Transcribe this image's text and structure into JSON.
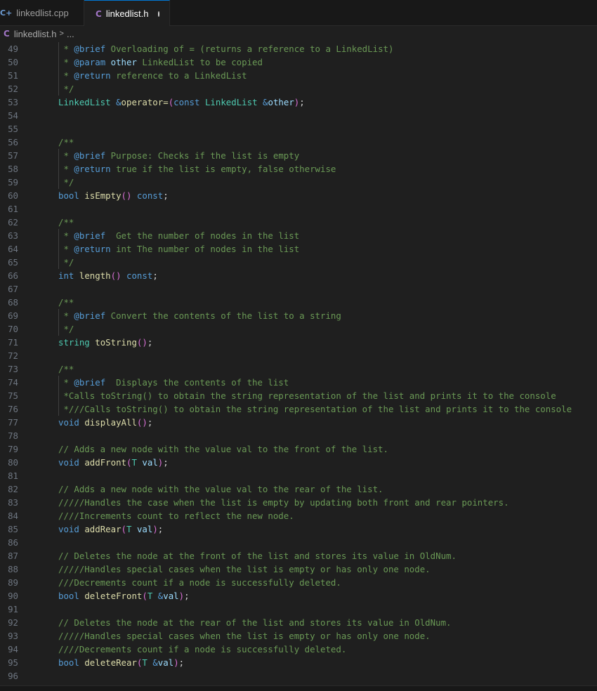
{
  "tabs": [
    {
      "icon": "C+",
      "label": "linkedlist.cpp",
      "active": false
    },
    {
      "icon": "C",
      "label": "linkedlist.h",
      "active": true,
      "dirty": true
    }
  ],
  "breadcrumb": {
    "icon": "C",
    "file": "linkedlist.h",
    "separator": ">",
    "rest": "..."
  },
  "editor": {
    "lines": [
      {
        "n": "49",
        "guide": true,
        "tokens": [
          [
            "comment",
            " * "
          ],
          [
            "doc",
            "@brief"
          ],
          [
            "comment",
            " Overloading of = (returns a reference to a LinkedList)"
          ]
        ]
      },
      {
        "n": "50",
        "guide": true,
        "tokens": [
          [
            "comment",
            " * "
          ],
          [
            "doc",
            "@param"
          ],
          [
            "comment",
            " "
          ],
          [
            "param",
            "other"
          ],
          [
            "comment",
            " LinkedList to be copied"
          ]
        ]
      },
      {
        "n": "51",
        "guide": true,
        "tokens": [
          [
            "comment",
            " * "
          ],
          [
            "doc",
            "@return"
          ],
          [
            "comment",
            " reference to a LinkedList"
          ]
        ]
      },
      {
        "n": "52",
        "guide": true,
        "tokens": [
          [
            "comment",
            " */"
          ]
        ]
      },
      {
        "n": "53",
        "guide": false,
        "tokens": [
          [
            "type",
            "LinkedList"
          ],
          [
            "plain",
            " "
          ],
          [
            "kw",
            "&"
          ],
          [
            "fn",
            "operator="
          ],
          [
            "paren1",
            "("
          ],
          [
            "kw",
            "const"
          ],
          [
            "plain",
            " "
          ],
          [
            "type",
            "LinkedList"
          ],
          [
            "plain",
            " "
          ],
          [
            "kw",
            "&"
          ],
          [
            "param",
            "other"
          ],
          [
            "paren1",
            ")"
          ],
          [
            "plain",
            ";"
          ]
        ]
      },
      {
        "n": "54",
        "guide": false,
        "tokens": []
      },
      {
        "n": "55",
        "guide": false,
        "tokens": []
      },
      {
        "n": "56",
        "guide": false,
        "tokens": [
          [
            "comment",
            "/**"
          ]
        ]
      },
      {
        "n": "57",
        "guide": true,
        "tokens": [
          [
            "comment",
            " * "
          ],
          [
            "doc",
            "@brief"
          ],
          [
            "comment",
            " Purpose: Checks if the list is empty"
          ]
        ]
      },
      {
        "n": "58",
        "guide": true,
        "tokens": [
          [
            "comment",
            " * "
          ],
          [
            "doc",
            "@return"
          ],
          [
            "comment",
            " true if the list is empty, false otherwise"
          ]
        ]
      },
      {
        "n": "59",
        "guide": true,
        "tokens": [
          [
            "comment",
            " */"
          ]
        ]
      },
      {
        "n": "60",
        "guide": false,
        "tokens": [
          [
            "kw",
            "bool"
          ],
          [
            "plain",
            " "
          ],
          [
            "fn",
            "isEmpty"
          ],
          [
            "paren1",
            "()"
          ],
          [
            "plain",
            " "
          ],
          [
            "kw",
            "const"
          ],
          [
            "plain",
            ";"
          ]
        ]
      },
      {
        "n": "61",
        "guide": false,
        "tokens": []
      },
      {
        "n": "62",
        "guide": false,
        "tokens": [
          [
            "comment",
            "/**"
          ]
        ]
      },
      {
        "n": "63",
        "guide": true,
        "tokens": [
          [
            "comment",
            " * "
          ],
          [
            "doc",
            "@brief"
          ],
          [
            "comment",
            "  Get the number of nodes in the list"
          ]
        ]
      },
      {
        "n": "64",
        "guide": true,
        "tokens": [
          [
            "comment",
            " * "
          ],
          [
            "doc",
            "@return"
          ],
          [
            "comment",
            " int The number of nodes in the list"
          ]
        ]
      },
      {
        "n": "65",
        "guide": true,
        "tokens": [
          [
            "comment",
            " */"
          ]
        ]
      },
      {
        "n": "66",
        "guide": false,
        "tokens": [
          [
            "kw",
            "int"
          ],
          [
            "plain",
            " "
          ],
          [
            "fn",
            "length"
          ],
          [
            "paren1",
            "()"
          ],
          [
            "plain",
            " "
          ],
          [
            "kw",
            "const"
          ],
          [
            "plain",
            ";"
          ]
        ]
      },
      {
        "n": "67",
        "guide": false,
        "tokens": []
      },
      {
        "n": "68",
        "guide": false,
        "tokens": [
          [
            "comment",
            "/**"
          ]
        ]
      },
      {
        "n": "69",
        "guide": true,
        "tokens": [
          [
            "comment",
            " * "
          ],
          [
            "doc",
            "@brief"
          ],
          [
            "comment",
            " Convert the contents of the list to a string"
          ]
        ]
      },
      {
        "n": "70",
        "guide": true,
        "tokens": [
          [
            "comment",
            " */"
          ]
        ]
      },
      {
        "n": "71",
        "guide": false,
        "tokens": [
          [
            "type",
            "string"
          ],
          [
            "plain",
            " "
          ],
          [
            "fn",
            "toString"
          ],
          [
            "paren1",
            "()"
          ],
          [
            "plain",
            ";"
          ]
        ]
      },
      {
        "n": "72",
        "guide": false,
        "tokens": []
      },
      {
        "n": "73",
        "guide": false,
        "tokens": [
          [
            "comment",
            "/**"
          ]
        ]
      },
      {
        "n": "74",
        "guide": true,
        "tokens": [
          [
            "comment",
            " * "
          ],
          [
            "doc",
            "@brief"
          ],
          [
            "comment",
            "  Displays the contents of the list"
          ]
        ]
      },
      {
        "n": "75",
        "guide": true,
        "tokens": [
          [
            "comment",
            " *Calls toString() to obtain the string representation of the list and prints it to the console"
          ]
        ]
      },
      {
        "n": "76",
        "guide": true,
        "tokens": [
          [
            "comment",
            " *///Calls toString() to obtain the string representation of the list and prints it to the console"
          ]
        ]
      },
      {
        "n": "77",
        "guide": false,
        "tokens": [
          [
            "kw",
            "void"
          ],
          [
            "plain",
            " "
          ],
          [
            "fn",
            "displayAll"
          ],
          [
            "paren1",
            "()"
          ],
          [
            "plain",
            ";"
          ]
        ]
      },
      {
        "n": "78",
        "guide": false,
        "tokens": []
      },
      {
        "n": "79",
        "guide": false,
        "tokens": [
          [
            "comment",
            "// Adds a new node with the value val to the front of the list."
          ]
        ]
      },
      {
        "n": "80",
        "guide": false,
        "tokens": [
          [
            "kw",
            "void"
          ],
          [
            "plain",
            " "
          ],
          [
            "fn",
            "addFront"
          ],
          [
            "paren1",
            "("
          ],
          [
            "type",
            "T"
          ],
          [
            "plain",
            " "
          ],
          [
            "param",
            "val"
          ],
          [
            "paren1",
            ")"
          ],
          [
            "plain",
            ";"
          ]
        ]
      },
      {
        "n": "81",
        "guide": false,
        "tokens": []
      },
      {
        "n": "82",
        "guide": false,
        "tokens": [
          [
            "comment",
            "// Adds a new node with the value val to the rear of the list."
          ]
        ]
      },
      {
        "n": "83",
        "guide": false,
        "tokens": [
          [
            "comment",
            "/////Handles the case when the list is empty by updating both front and rear pointers."
          ]
        ]
      },
      {
        "n": "84",
        "guide": false,
        "tokens": [
          [
            "comment",
            "////Increments count to reflect the new node."
          ]
        ]
      },
      {
        "n": "85",
        "guide": false,
        "tokens": [
          [
            "kw",
            "void"
          ],
          [
            "plain",
            " "
          ],
          [
            "fn",
            "addRear"
          ],
          [
            "paren1",
            "("
          ],
          [
            "type",
            "T"
          ],
          [
            "plain",
            " "
          ],
          [
            "param",
            "val"
          ],
          [
            "paren1",
            ")"
          ],
          [
            "plain",
            ";"
          ]
        ]
      },
      {
        "n": "86",
        "guide": false,
        "tokens": []
      },
      {
        "n": "87",
        "guide": false,
        "tokens": [
          [
            "comment",
            "// Deletes the node at the front of the list and stores its value in OldNum."
          ]
        ]
      },
      {
        "n": "88",
        "guide": false,
        "tokens": [
          [
            "comment",
            "/////Handles special cases when the list is empty or has only one node."
          ]
        ]
      },
      {
        "n": "89",
        "guide": false,
        "tokens": [
          [
            "comment",
            "///Decrements count if a node is successfully deleted."
          ]
        ]
      },
      {
        "n": "90",
        "guide": false,
        "tokens": [
          [
            "kw",
            "bool"
          ],
          [
            "plain",
            " "
          ],
          [
            "fn",
            "deleteFront"
          ],
          [
            "paren1",
            "("
          ],
          [
            "type",
            "T"
          ],
          [
            "plain",
            " "
          ],
          [
            "kw",
            "&"
          ],
          [
            "param",
            "val"
          ],
          [
            "paren1",
            ")"
          ],
          [
            "plain",
            ";"
          ]
        ]
      },
      {
        "n": "91",
        "guide": false,
        "tokens": []
      },
      {
        "n": "92",
        "guide": false,
        "tokens": [
          [
            "comment",
            "// Deletes the node at the rear of the list and stores its value in OldNum."
          ]
        ]
      },
      {
        "n": "93",
        "guide": false,
        "tokens": [
          [
            "comment",
            "/////Handles special cases when the list is empty or has only one node."
          ]
        ]
      },
      {
        "n": "94",
        "guide": false,
        "tokens": [
          [
            "comment",
            "////Decrements count if a node is successfully deleted."
          ]
        ]
      },
      {
        "n": "95",
        "guide": false,
        "tokens": [
          [
            "kw",
            "bool"
          ],
          [
            "plain",
            " "
          ],
          [
            "fn",
            "deleteRear"
          ],
          [
            "paren1",
            "("
          ],
          [
            "type",
            "T"
          ],
          [
            "plain",
            " "
          ],
          [
            "kw",
            "&"
          ],
          [
            "param",
            "val"
          ],
          [
            "paren1",
            ")"
          ],
          [
            "plain",
            ";"
          ]
        ]
      },
      {
        "n": "96",
        "guide": false,
        "tokens": []
      }
    ]
  }
}
